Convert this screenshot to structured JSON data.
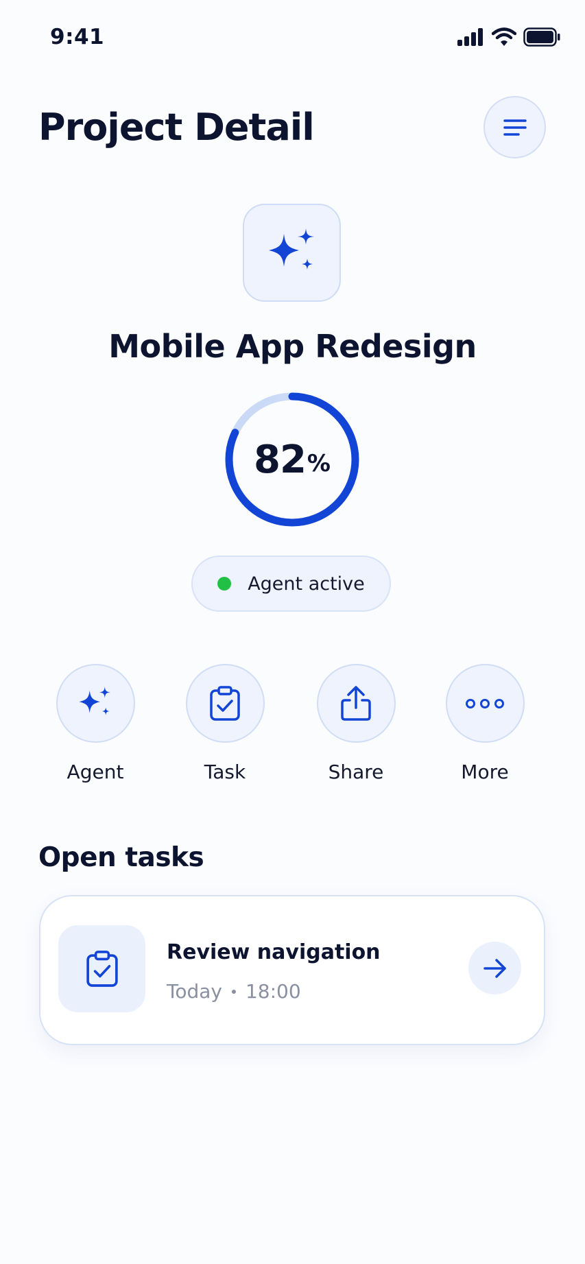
{
  "status_bar": {
    "time": "9:41",
    "icons": [
      "cellular-signal-icon",
      "wifi-icon",
      "battery-icon"
    ]
  },
  "header": {
    "title": "Project Detail",
    "menu_icon": "menu-lines-icon"
  },
  "project": {
    "icon": "sparkles-icon",
    "name": "Mobile App Redesign",
    "progress_value": "82",
    "progress_unit": "%",
    "progress_fraction": 0.82,
    "agent_status": "Agent active",
    "agent_status_color": "#22c145"
  },
  "actions": [
    {
      "label": "Agent",
      "icon": "sparkles-icon"
    },
    {
      "label": "Task",
      "icon": "clipboard-check-icon"
    },
    {
      "label": "Share",
      "icon": "share-upload-icon"
    },
    {
      "label": "More",
      "icon": "more-dots-icon"
    }
  ],
  "open_tasks": {
    "title": "Open tasks",
    "items": [
      {
        "title": "Review navigation",
        "day": "Today",
        "time": "18:00",
        "icon": "clipboard-check-icon",
        "action_icon": "arrow-right-icon"
      }
    ]
  },
  "colors": {
    "accent": "#1245d6",
    "accent_light": "#eef3fd",
    "text_primary": "#0d1430",
    "text_secondary": "#8a90a2"
  }
}
